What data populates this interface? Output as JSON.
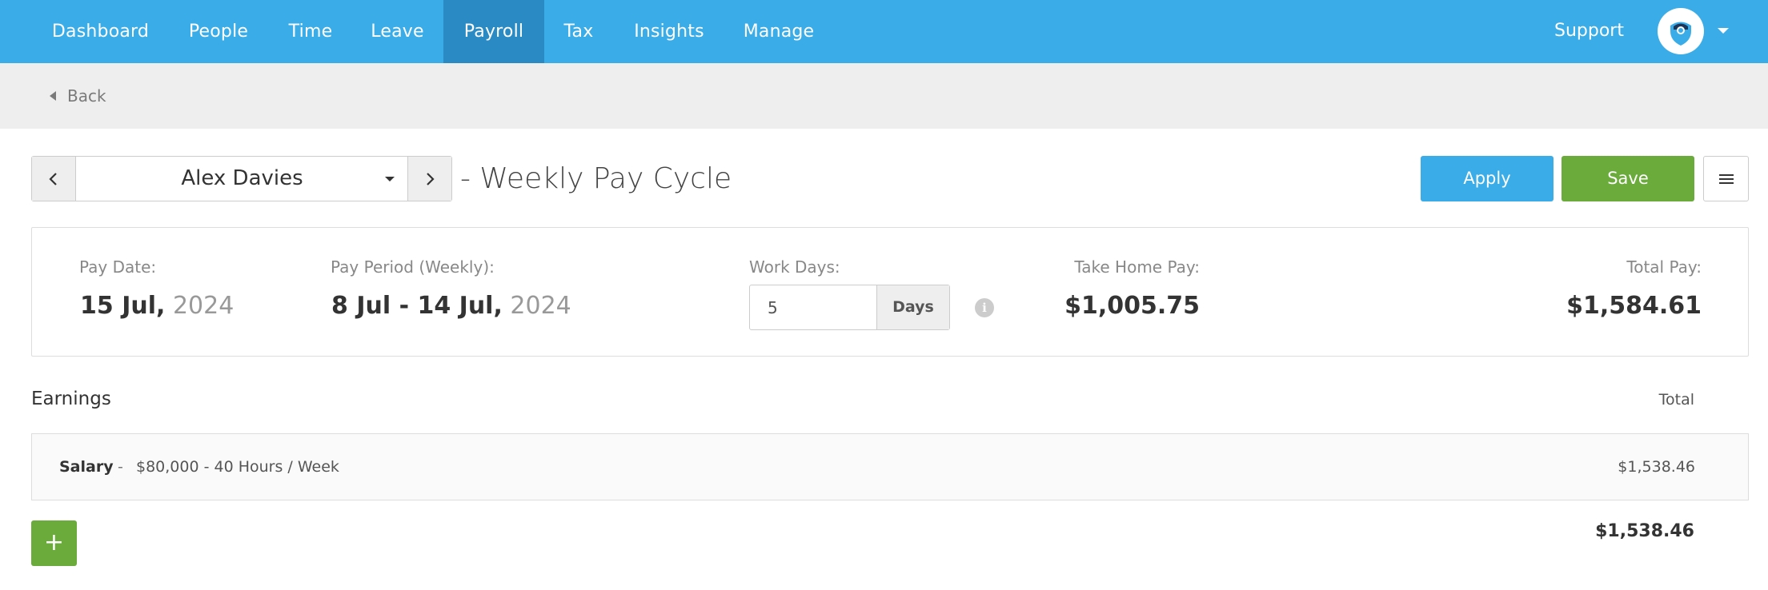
{
  "nav": {
    "items": [
      {
        "label": "Dashboard",
        "active": false
      },
      {
        "label": "People",
        "active": false
      },
      {
        "label": "Time",
        "active": false
      },
      {
        "label": "Leave",
        "active": false
      },
      {
        "label": "Payroll",
        "active": true
      },
      {
        "label": "Tax",
        "active": false
      },
      {
        "label": "Insights",
        "active": false
      },
      {
        "label": "Manage",
        "active": false
      }
    ],
    "support_label": "Support",
    "avatar_icon": "user-avatar-icon"
  },
  "back_label": "Back",
  "employee": {
    "name": "Alex Davies",
    "cycle_title": "- Weekly Pay Cycle"
  },
  "actions": {
    "apply_label": "Apply",
    "save_label": "Save",
    "menu_icon": "hamburger-menu-icon"
  },
  "summary": {
    "pay_date_label": "Pay Date:",
    "pay_date_day": "15 Jul,",
    "pay_date_year": "2024",
    "pay_period_label": "Pay Period (Weekly):",
    "pay_period_range": "8 Jul - 14 Jul,",
    "pay_period_year": "2024",
    "work_days_label": "Work Days:",
    "work_days_value": "5",
    "work_days_unit": "Days",
    "take_home_label": "Take Home Pay:",
    "take_home_value": "$1,005.75",
    "total_pay_label": "Total Pay:",
    "total_pay_value": "$1,584.61"
  },
  "earnings": {
    "title": "Earnings",
    "total_header": "Total",
    "rows": [
      {
        "name": "Salary",
        "separator": "-",
        "description": "$80,000 - 40 Hours / Week",
        "amount": "$1,538.46"
      }
    ],
    "grand_total": "$1,538.46",
    "add_label": "+"
  },
  "colors": {
    "brand_blue": "#3aace8",
    "nav_active": "#2a8bc4",
    "save_green": "#6aab3b"
  }
}
